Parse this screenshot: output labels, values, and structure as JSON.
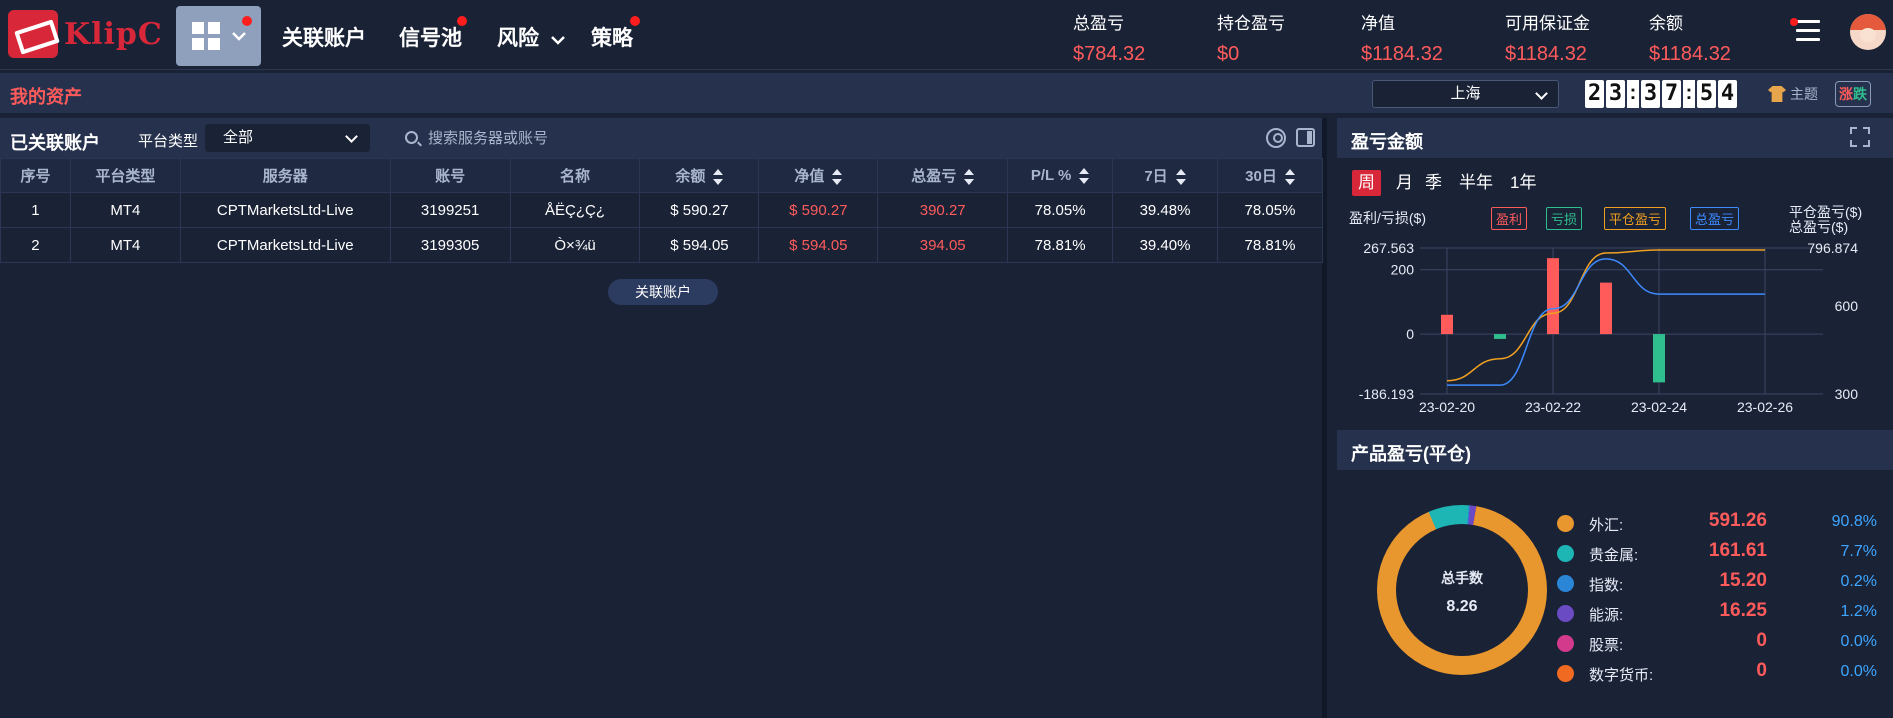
{
  "brand": {
    "name": "KlipC"
  },
  "nav": {
    "items": [
      {
        "label": "关联账户"
      },
      {
        "label": "信号池"
      },
      {
        "label": "风险"
      },
      {
        "label": "策略"
      }
    ]
  },
  "stats": [
    {
      "label": "总盈亏",
      "value": "$784.32"
    },
    {
      "label": "持仓盈亏",
      "value": "$0"
    },
    {
      "label": "净值",
      "value": "$1184.32"
    },
    {
      "label": "可用保证金",
      "value": "$1184.32"
    },
    {
      "label": "余额",
      "value": "$1184.32"
    }
  ],
  "assets_bar": {
    "title": "我的资产",
    "city": "上海",
    "clock": [
      "2",
      "3",
      "3",
      "7",
      "5",
      "4"
    ],
    "theme_label": "主题",
    "updown_label": "涨跌"
  },
  "accounts": {
    "title": "已关联账户",
    "platform_label": "平台类型",
    "platform_value": "全部",
    "search_placeholder": "搜索服务器或账号",
    "columns": [
      "序号",
      "平台类型",
      "服务器",
      "账号",
      "名称",
      "余额",
      "净值",
      "总盈亏",
      "P/L %",
      "7日",
      "30日"
    ],
    "rows": [
      [
        "1",
        "MT4",
        "CPTMarketsLtd-Live",
        "3199251",
        "ÅËÇ¿Ç¿",
        "$ 590.27",
        "$ 590.27",
        "390.27",
        "78.05%",
        "39.48%",
        "78.05%"
      ],
      [
        "2",
        "MT4",
        "CPTMarketsLtd-Live",
        "3199305",
        "Ò×¾ü",
        "$ 594.05",
        "$ 594.05",
        "394.05",
        "78.81%",
        "39.40%",
        "78.81%"
      ]
    ],
    "link_button": "关联账户"
  },
  "pl_panel": {
    "title": "盈亏金额",
    "periods": [
      "周",
      "月",
      "季",
      "半年",
      "1年"
    ],
    "active_period": "周"
  },
  "chart_data": {
    "type": "bar",
    "ylabel": "盈利/亏损($)",
    "ylabel_right": [
      "平仓盈亏($)",
      "总盈亏($)"
    ],
    "legend": [
      {
        "name": "盈利",
        "color": "#ff5b5b"
      },
      {
        "name": "亏损",
        "color": "#2fbf8f"
      },
      {
        "name": "平仓盈亏",
        "color": "#f0a020"
      },
      {
        "name": "总盈亏",
        "color": "#3d8bff"
      }
    ],
    "ylim": [
      -186.193,
      267.563
    ],
    "yticks": [
      "267.563",
      "200",
      "0",
      "-186.193"
    ],
    "y2lim": [
      300,
      796.874
    ],
    "y2ticks": [
      "796.874",
      "600",
      "300"
    ],
    "xticks": [
      "23-02-20",
      "23-02-22",
      "23-02-24",
      "23-02-26"
    ],
    "x": [
      "23-02-20",
      "23-02-21",
      "23-02-22",
      "23-02-23",
      "23-02-24",
      "23-02-25",
      "23-02-26"
    ],
    "series": [
      {
        "name": "盈利",
        "values": [
          60,
          0,
          236,
          160,
          0,
          0,
          0
        ]
      },
      {
        "name": "亏损",
        "values": [
          0,
          -15,
          0,
          0,
          -150,
          0,
          0
        ]
      },
      {
        "name": "平仓盈亏",
        "values": [
          345,
          420,
          575,
          780,
          790,
          790,
          790
        ]
      },
      {
        "name": "总盈亏",
        "values": [
          330,
          330,
          590,
          760,
          640,
          640,
          640
        ]
      }
    ]
  },
  "product_panel": {
    "title": "产品盈亏(平仓)",
    "center_label": "总手数",
    "center_value": "8.26",
    "items": [
      {
        "name": "外汇:",
        "value": "591.26",
        "pct": "90.8%",
        "color": "#e8962e"
      },
      {
        "name": "贵金属:",
        "value": "161.61",
        "pct": "7.7%",
        "color": "#1eb5b5"
      },
      {
        "name": "指数:",
        "value": "15.20",
        "pct": "0.2%",
        "color": "#2b86d8"
      },
      {
        "name": "能源:",
        "value": "16.25",
        "pct": "1.2%",
        "color": "#6a4bc4"
      },
      {
        "name": "股票:",
        "value": "0",
        "pct": "0.0%",
        "color": "#d33a8b"
      },
      {
        "name": "数字货币:",
        "value": "0",
        "pct": "0.0%",
        "color": "#f06a22"
      }
    ]
  }
}
